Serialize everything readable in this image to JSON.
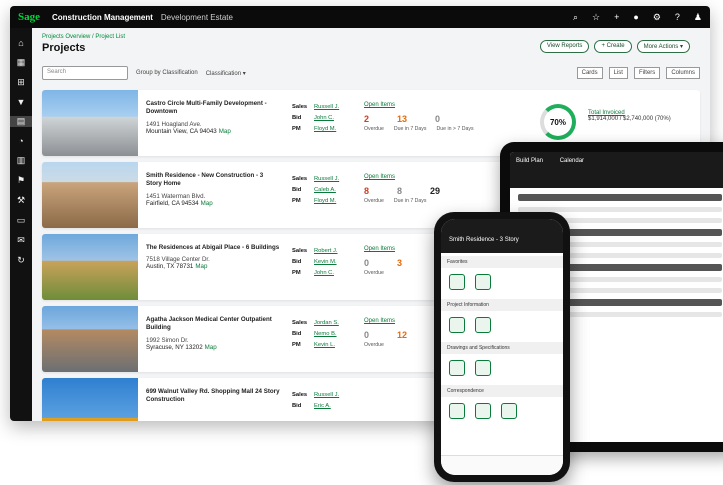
{
  "app": {
    "logo": "Sage",
    "title": "Construction Management",
    "context": "Development Estate"
  },
  "topbar_icons": [
    "search-icon",
    "star-icon",
    "plus-icon",
    "bell-icon",
    "gear-icon",
    "help-icon",
    "user-icon"
  ],
  "breadcrumb": "Projects Overview / Project List",
  "page_title": "Projects",
  "header_buttons": {
    "view_reports": "View Reports",
    "create": "+ Create",
    "more_actions": "More Actions ▾"
  },
  "toolbar": {
    "search_placeholder": "Search",
    "group_by": "Group by Classification",
    "classification": "Classification ▾",
    "cards": "Cards",
    "list": "List",
    "filters": "Filters",
    "columns": "Columns"
  },
  "projects": [
    {
      "name": "Castro Circle Multi-Family Development - Downtown",
      "addr": "1491 Hoagland Ave.",
      "city": "Mountain View, CA 94043",
      "map": "Map",
      "sales": "Russell J.",
      "bid": "John C.",
      "pm": "Floyd M.",
      "items_label": "Open Items",
      "overdue": "2",
      "due7": "13",
      "gt7": "0"
    },
    {
      "name": "Smith Residence - New Construction - 3 Story Home",
      "addr": "1451 Waterman Blvd.",
      "city": "Fairfield, CA 94534",
      "map": "Map",
      "sales": "Russell J.",
      "bid": "Caleb A.",
      "pm": "Floyd M.",
      "items_label": "Open Items",
      "overdue": "8",
      "due7": "8",
      "gt7": "29"
    },
    {
      "name": "The Residences at Abigail Place - 6 Buildings",
      "addr": "7518 Village Center Dr.",
      "city": "Austin, TX 78731",
      "map": "Map",
      "sales": "Robert J.",
      "bid": "Kevin M.",
      "pm": "John C.",
      "items_label": "Open Items",
      "overdue": "0",
      "due7": "3",
      "gt7": ""
    },
    {
      "name": "Agatha Jackson Medical Center Outpatient Building",
      "addr": "1992 Simon Dr.",
      "city": "Syracuse, NY 13202",
      "map": "Map",
      "sales": "Jordan S.",
      "bid": "Nemo B.",
      "pm": "Kevin L.",
      "items_label": "Open Items",
      "overdue": "0",
      "due7": "12",
      "gt7": ""
    },
    {
      "name": "699 Walnut Valley Rd. Shopping Mall 24 Story Construction",
      "addr": "",
      "city": "",
      "map": "",
      "sales": "Russell J.",
      "bid": "Eric A.",
      "pm": "",
      "items_label": "",
      "overdue": "",
      "due7": "",
      "gt7": ""
    }
  ],
  "labels": {
    "sales": "Sales",
    "bid": "Bid",
    "pm": "PM",
    "overdue": "Overdue",
    "due7": "Due in 7 Days",
    "gt7": "Due in > 7 Days"
  },
  "progress": {
    "percent": "70%",
    "label": "Total Invoiced",
    "value": "$1,914,000 / $2,740,000 (70%)"
  },
  "phone": {
    "title": "Smith Residence - 3 Story",
    "sections": [
      "Favorites",
      "Project Information",
      "Drawings and Specifications",
      "Correspondence"
    ]
  },
  "tablet": {
    "tab1": "Build Plan",
    "tab2": "Calendar"
  }
}
